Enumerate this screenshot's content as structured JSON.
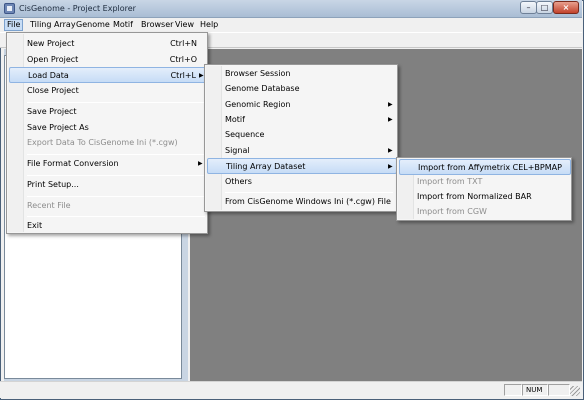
{
  "window": {
    "title": "CisGenome - Project Explorer"
  },
  "menubar": {
    "items": [
      {
        "label": "File"
      },
      {
        "label": "Tiling Array"
      },
      {
        "label": "Genome"
      },
      {
        "label": "Motif"
      },
      {
        "label": "Browser"
      },
      {
        "label": "View"
      },
      {
        "label": "Help"
      }
    ]
  },
  "file_menu": {
    "items": [
      {
        "label": "New Project",
        "shortcut": "Ctrl+N"
      },
      {
        "label": "Open Project",
        "shortcut": "Ctrl+O"
      },
      {
        "label": "Load Data",
        "shortcut": "Ctrl+L"
      },
      {
        "label": "Close Project"
      },
      {
        "label": "Save Project"
      },
      {
        "label": "Save Project As"
      },
      {
        "label": "Export Data To CisGenome Ini (*.cgw)",
        "disabled": true
      },
      {
        "label": "File Format Conversion"
      },
      {
        "label": "Print Setup..."
      },
      {
        "label": "Recent File",
        "disabled": true
      },
      {
        "label": "Exit"
      }
    ]
  },
  "load_data_menu": {
    "items": [
      {
        "label": "Browser Session"
      },
      {
        "label": "Genome Database"
      },
      {
        "label": "Genomic Region"
      },
      {
        "label": "Motif"
      },
      {
        "label": "Sequence"
      },
      {
        "label": "Signal"
      },
      {
        "label": "Tiling Array Dataset"
      },
      {
        "label": "Others"
      },
      {
        "label": "From CisGenome Windows Ini (*.cgw) File"
      }
    ]
  },
  "tiling_menu": {
    "items": [
      {
        "label": "Import from Affymetrix CEL+BPMAP"
      },
      {
        "label": "Import from TXT",
        "disabled": true
      },
      {
        "label": "Import from Normalized BAR"
      },
      {
        "label": "Import from CGW",
        "disabled": true
      }
    ]
  },
  "statusbar": {
    "num": "NUM"
  },
  "icons": {
    "submenu": "chevron-right-icon",
    "app": "app-icon",
    "minimize": "minimize-icon",
    "maximize": "maximize-icon",
    "close": "close-icon"
  },
  "colors": {
    "highlight": "#c6dcf6",
    "mdi_background": "#808080",
    "disabled_text": "#8d8d8d"
  }
}
